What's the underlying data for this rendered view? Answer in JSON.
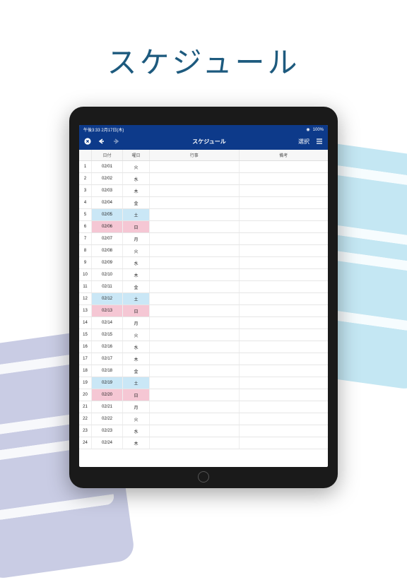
{
  "page_title": "スケジュール",
  "statusbar": {
    "time": "午後3:33",
    "date": "2月17日(木)",
    "wifi": "◉",
    "battery": "100%"
  },
  "navbar": {
    "close_icon": "✕",
    "undo_icon": "↶",
    "redo_icon": "↷",
    "title": "スケジュール",
    "select_label": "選択",
    "menu_icon": "≡"
  },
  "columns": {
    "idx": "",
    "date": "日付",
    "day": "曜日",
    "event": "行事",
    "note": "備考"
  },
  "rows": [
    {
      "i": "1",
      "date": "02/01",
      "day": "火",
      "t": ""
    },
    {
      "i": "2",
      "date": "02/02",
      "day": "水",
      "t": ""
    },
    {
      "i": "3",
      "date": "02/03",
      "day": "木",
      "t": ""
    },
    {
      "i": "4",
      "date": "02/04",
      "day": "金",
      "t": ""
    },
    {
      "i": "5",
      "date": "02/05",
      "day": "土",
      "t": "sat"
    },
    {
      "i": "6",
      "date": "02/06",
      "day": "日",
      "t": "sun"
    },
    {
      "i": "7",
      "date": "02/07",
      "day": "月",
      "t": ""
    },
    {
      "i": "8",
      "date": "02/08",
      "day": "火",
      "t": ""
    },
    {
      "i": "9",
      "date": "02/09",
      "day": "水",
      "t": ""
    },
    {
      "i": "10",
      "date": "02/10",
      "day": "木",
      "t": ""
    },
    {
      "i": "11",
      "date": "02/11",
      "day": "金",
      "t": ""
    },
    {
      "i": "12",
      "date": "02/12",
      "day": "土",
      "t": "sat"
    },
    {
      "i": "13",
      "date": "02/13",
      "day": "日",
      "t": "sun"
    },
    {
      "i": "14",
      "date": "02/14",
      "day": "月",
      "t": ""
    },
    {
      "i": "15",
      "date": "02/15",
      "day": "火",
      "t": ""
    },
    {
      "i": "16",
      "date": "02/16",
      "day": "水",
      "t": ""
    },
    {
      "i": "17",
      "date": "02/17",
      "day": "木",
      "t": ""
    },
    {
      "i": "18",
      "date": "02/18",
      "day": "金",
      "t": ""
    },
    {
      "i": "19",
      "date": "02/19",
      "day": "土",
      "t": "sat"
    },
    {
      "i": "20",
      "date": "02/20",
      "day": "日",
      "t": "sun"
    },
    {
      "i": "21",
      "date": "02/21",
      "day": "月",
      "t": ""
    },
    {
      "i": "22",
      "date": "02/22",
      "day": "火",
      "t": ""
    },
    {
      "i": "23",
      "date": "02/23",
      "day": "水",
      "t": ""
    },
    {
      "i": "24",
      "date": "02/24",
      "day": "木",
      "t": ""
    }
  ]
}
